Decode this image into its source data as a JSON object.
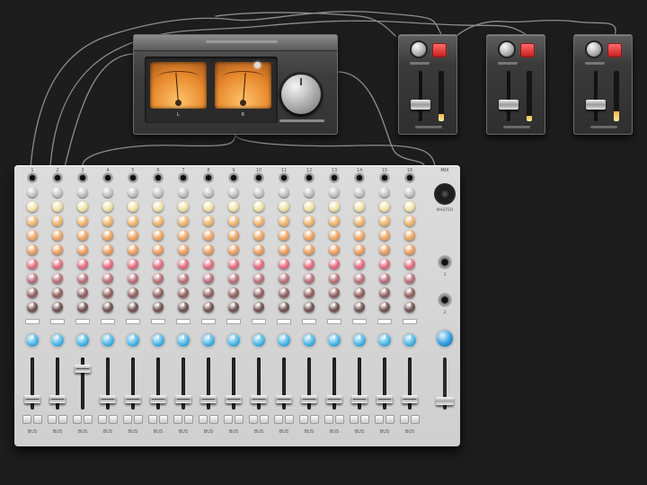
{
  "meter_unit": {
    "left_meter_label": "L",
    "right_meter_label": "R",
    "left_level": 0.45,
    "right_level": 0.55
  },
  "fader_units": [
    {
      "level": 0.3,
      "meter": 0.15
    },
    {
      "level": 0.3,
      "meter": 0.1
    },
    {
      "level": 0.3,
      "meter": 0.2
    }
  ],
  "mixer": {
    "master_label": "MIX",
    "master_knob_label": "MASTER",
    "output_labels": [
      "1",
      "2"
    ],
    "master_fader": 0.15,
    "channel_numbers": [
      "1",
      "2",
      "3",
      "4",
      "5",
      "6",
      "7",
      "8",
      "9",
      "10",
      "11",
      "12",
      "13",
      "14",
      "15",
      "16"
    ],
    "channel_names": [
      "BUS",
      "BUS",
      "BUS",
      "BUS",
      "BUS",
      "BUS",
      "BUS",
      "BUS",
      "BUS",
      "BUS",
      "BUS",
      "BUS",
      "BUS",
      "BUS",
      "BUS",
      "BUS"
    ],
    "fader_levels": [
      0.2,
      0.2,
      0.85,
      0.2,
      0.2,
      0.2,
      0.2,
      0.2,
      0.2,
      0.2,
      0.2,
      0.2,
      0.2,
      0.2,
      0.2,
      0.2
    ]
  },
  "colors": {
    "eq_knob_colors": [
      "#f1e3a4",
      "#f2b366",
      "#f0a35e",
      "#ec9a5a",
      "#e5667b",
      "#b56a74",
      "#8c5a58",
      "#6a4b48"
    ],
    "pan_knob": "#4bb6e6",
    "master_pan_knob": "#2f9fe0",
    "meter_amber": "#e88a2e",
    "mute_red": "#d82a2a"
  }
}
